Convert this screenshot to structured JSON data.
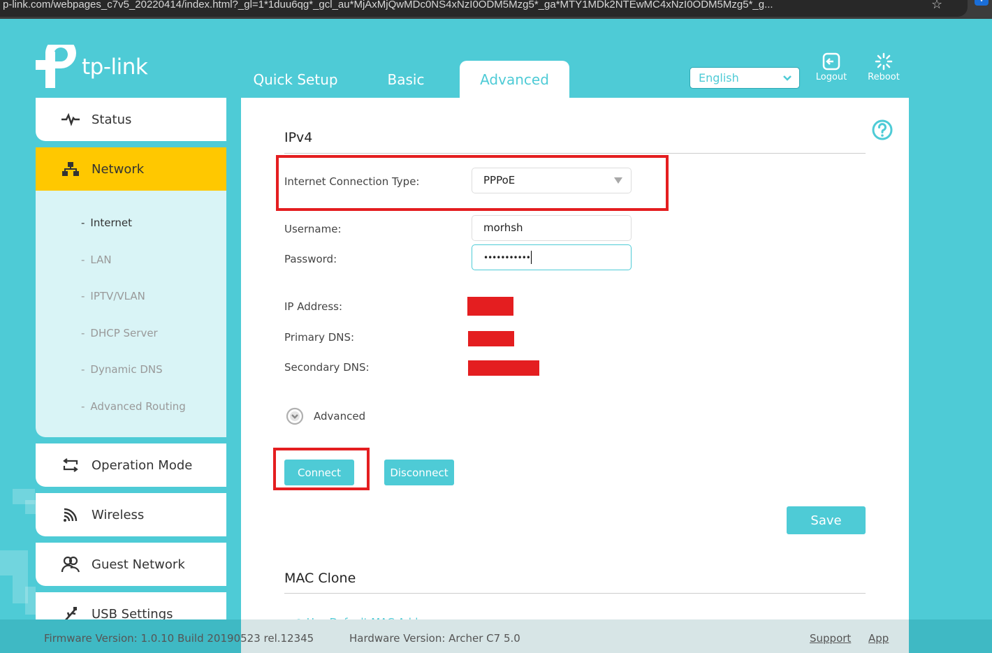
{
  "browser": {
    "url": "p-link.com/webpages_c7v5_20220414/index.html?_gl=1*1duu6qg*_gcl_au*MjAxMjQwMDc0NS4xNzI0ODM5Mzg5*_ga*MTY1MDk2NTEwMC4xNzI0ODM5Mzg5*_g..."
  },
  "header": {
    "brand": "tp-link",
    "tabs": [
      {
        "label": "Quick Setup",
        "active": false
      },
      {
        "label": "Basic",
        "active": false
      },
      {
        "label": "Advanced",
        "active": true
      }
    ],
    "language": {
      "selected": "English"
    },
    "actions": {
      "logout": "Logout",
      "reboot": "Reboot"
    }
  },
  "sidebar": {
    "items": [
      {
        "label": "Status",
        "icon": "pulse-icon",
        "active": false
      },
      {
        "label": "Network",
        "icon": "network-tree-icon",
        "active": true
      },
      {
        "label": "Operation Mode",
        "icon": "mode-switch-icon",
        "active": false
      },
      {
        "label": "Wireless",
        "icon": "wifi-icon",
        "active": false
      },
      {
        "label": "Guest Network",
        "icon": "guests-icon",
        "active": false
      },
      {
        "label": "USB Settings",
        "icon": "usb-icon",
        "active": false
      }
    ],
    "submenu": [
      {
        "label": "Internet",
        "active": true
      },
      {
        "label": "LAN",
        "active": false
      },
      {
        "label": "IPTV/VLAN",
        "active": false
      },
      {
        "label": "DHCP Server",
        "active": false
      },
      {
        "label": "Dynamic DNS",
        "active": false
      },
      {
        "label": "Advanced Routing",
        "active": false
      }
    ],
    "dash": "-"
  },
  "main": {
    "ipv4": {
      "title": "IPv4",
      "connection_type_label": "Internet Connection Type:",
      "connection_type_value": "PPPoE",
      "username_label": "Username:",
      "username_value": "morhsh",
      "password_label": "Password:",
      "password_masked": "•••••••••••",
      "ip_address_label": "IP Address:",
      "primary_dns_label": "Primary DNS:",
      "secondary_dns_label": "Secondary DNS:",
      "advanced_label": "Advanced",
      "connect_label": "Connect",
      "disconnect_label": "Disconnect",
      "save_label": "Save"
    },
    "mac_clone": {
      "title": "MAC Clone",
      "option_default": "Use Default MAC Address"
    }
  },
  "footer": {
    "firmware": "Firmware Version: 1.0.10 Build 20190523 rel.12345",
    "hardware": "Hardware Version: Archer C7 5.0",
    "support": "Support",
    "app": "App"
  },
  "colors": {
    "brand": "#4ecbd6",
    "active_nav": "#ffc800",
    "annotation": "#e41e20"
  }
}
